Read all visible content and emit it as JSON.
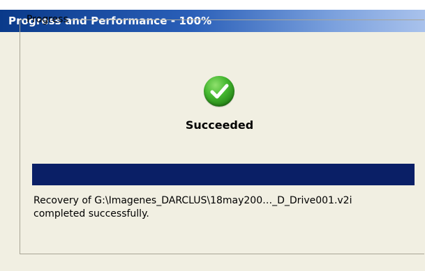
{
  "window": {
    "title": "Progress and Performance - 100%"
  },
  "progress_group": {
    "legend": "Progress",
    "status_icon": "checkmark-success-icon",
    "status_text": "Succeeded",
    "progress_fraction": 1.0,
    "message_line1": "Recovery of G:\\Imagenes_DARCLUS\\18may200…_D_Drive001.v2i",
    "message_line2": "completed successfully."
  },
  "colors": {
    "title_bar": "#0a3a8a",
    "progress_fill": "#0a1f66",
    "success_green": "#45b830"
  }
}
